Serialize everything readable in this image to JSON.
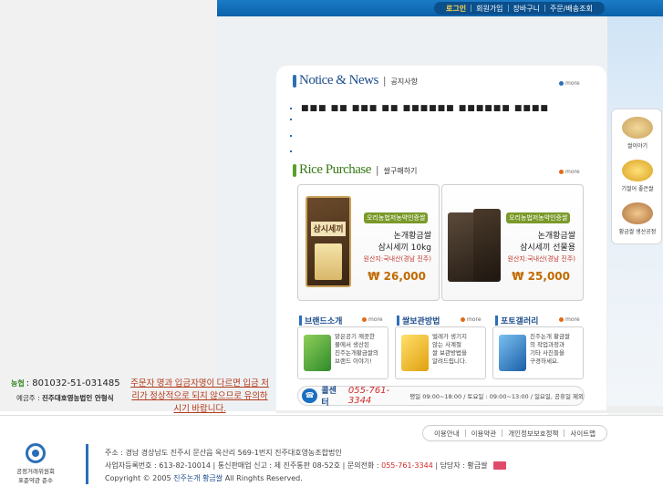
{
  "topnav": {
    "items": [
      "로그인",
      "회원가입",
      "장바구니",
      "주문/배송조회"
    ]
  },
  "notice": {
    "title": "Notice & News",
    "sub": "공지사항",
    "more": "more",
    "items": [
      "■■■ ■■ ■■■ ■■ ■■■■■■ ■■■■■■ ■■■■",
      "",
      "",
      ""
    ]
  },
  "purchase": {
    "title": "Rice Purchase",
    "sub": "쌀구매하기",
    "more": "more",
    "products": [
      {
        "bag_label": "삼시세끼",
        "tag": "오리농법저농약인증쌀",
        "name1": "논개황금쌀",
        "name2": "삼시세끼 10kg",
        "origin": "원산지:국내산(경남 진주)",
        "price": "₩ 26,000"
      },
      {
        "tag": "오리농법저농약인증쌀",
        "name1": "논개황금쌀",
        "name2": "삼시세끼 선물용",
        "origin": "원산지:국내산(경남 진주)",
        "price": "₩ 25,000"
      }
    ]
  },
  "boxes": [
    {
      "title": "브랜드소개",
      "more": "more",
      "desc": "맑은공기 깨끗한\n물에서 생산된\n진주논개황금쌀의\n브랜드 이야기!"
    },
    {
      "title": "쌀보관방법",
      "more": "more",
      "desc": "벌레가 생기지\n않는 사계절\n쌀 보관방법을\n알려드립니다."
    },
    {
      "title": "포토갤러리",
      "more": "more",
      "desc": "진주논개 황금쌀\n의 작업과정과\n기타 사진들을\n구경하세요."
    }
  ],
  "callcenter": {
    "label": "콜센터",
    "phone": "055-761-3344",
    "hours": "평일 09:00~18:00 / 토요일 : 09:00~13:00 / 일요일, 공휴일 제외"
  },
  "side": {
    "items": [
      "쌀이야기",
      "기절어 좋은쌀",
      "황금쌀 생산공정"
    ]
  },
  "account": {
    "bank_logo": "농협",
    "number": ": 801032-51-031485",
    "holder_prefix": "예금주 :",
    "holder_name": "진주대호영농법인 안형식"
  },
  "warning": "주문자 명과 입금자명이 다르면 입금 처리가 정상적으로 되지 않으므로 유의하시기 바랍니다.",
  "footer": {
    "menu": [
      "이용안내",
      "이용약관",
      "개인정보보호정책",
      "사이트맵"
    ],
    "seal_line1": "공정거래위원회",
    "seal_line2": "표준약관 준수",
    "address": "주소 : 경남 경상남도 진주시 문산읍 옥산리 569-1번지   진주대호영농조합법인",
    "business": "사업자등록번호 : 613-82-10014   |   통신판매업 신고 : 제 진주통판 08-52호   |   문의전화 :",
    "business_phone": "055-761-3344",
    "manager": "|   담당자 : 황금쌀",
    "copyright_prefix": "Copyright  ©  2005",
    "copyright_brand": "진주논개 황금쌀",
    "copyright_suffix": "All Ringhts Reserved."
  },
  "colors": {
    "topbar": "#0b62ab",
    "accent_orange": "#e06a1a",
    "price": "#c06a00",
    "navy": "#1d4d8c"
  }
}
